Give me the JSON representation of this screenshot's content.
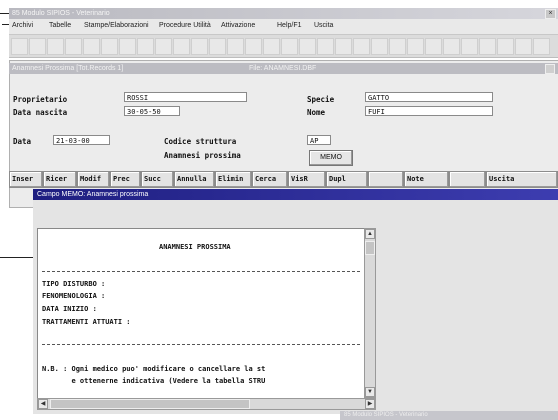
{
  "window": {
    "title": "85 Modulo SIPIOS - Veterinario",
    "close_glyph": "×"
  },
  "menu": [
    "Archivi",
    "Tabelle",
    "Stampe/Elaborazioni",
    "Procedure Utilità",
    "Attivazione",
    "Help/F1",
    "Uscita"
  ],
  "form": {
    "title": "Anamnesi Prossima [Tot.Records 1]",
    "file_label": "File: ANAMNESI.DBF",
    "labels": {
      "owner": "Proprietario",
      "birth": "Data nascita",
      "species": "Specie",
      "name": "Nome",
      "date": "Data",
      "structure_code": "Codice struttura",
      "anamnesis": "Anamnesi prossima"
    },
    "values": {
      "owner": "ROSSI",
      "birth": "30-05-50",
      "species": "GATTO",
      "name": "FUFI",
      "date": "21-03-00",
      "structure_code": "AP"
    },
    "memo_button": "MEMO"
  },
  "actions": [
    "Inser",
    "Ricer",
    "Modif",
    "Prec",
    "Succ",
    "Annulla",
    "Elimin",
    "Cerca",
    "VisR",
    "Dupl",
    "",
    "Note",
    "",
    "Uscita"
  ],
  "memo": {
    "title": "Campo MEMO: Anamnesi prossima",
    "heading": "ANAMNESI PROSSIMA",
    "fields": [
      "TIPO DISTURBO :",
      "FENOMENOLOGIA :",
      "DATA INIZIO :",
      "TRATTAMENTI ATTUATI :"
    ],
    "note_line1": "N.B. : Ogni medico puo' modificare o cancellare la st",
    "note_line2": "       e ottenerne indicativa (Vedere la tabella STRU"
  },
  "taskbar": "85 Modulo SIPIOS - Veterinario"
}
